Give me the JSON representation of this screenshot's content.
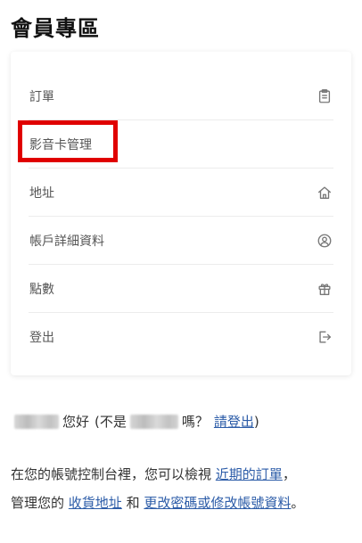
{
  "page": {
    "title": "會員專區"
  },
  "menu": {
    "items": [
      {
        "label": "訂單",
        "icon": "clipboard-icon"
      },
      {
        "label": "影音卡管理",
        "icon": ""
      },
      {
        "label": "地址",
        "icon": "home-icon"
      },
      {
        "label": "帳戶詳細資料",
        "icon": "user-circle-icon"
      },
      {
        "label": "點數",
        "icon": "gift-icon"
      },
      {
        "label": "登出",
        "icon": "logout-icon"
      }
    ],
    "highlight_color": "#e00000"
  },
  "greeting": {
    "hello": "您好",
    "not_prefix": "(不是",
    "question": "嗎？",
    "logout_link": "請登出",
    "close_paren": ")"
  },
  "account_text": {
    "line1_prefix": "在您的帳號控制台裡，您可以檢視",
    "recent_orders_link": "近期的訂單",
    "line1_suffix": "，",
    "line2_prefix": "管理您的",
    "addresses_link": "收貨地址",
    "and": "和",
    "edit_link": "更改密碼或修改帳號資料",
    "end": "。"
  },
  "colors": {
    "link": "#2c5ca8",
    "title": "#111111"
  }
}
